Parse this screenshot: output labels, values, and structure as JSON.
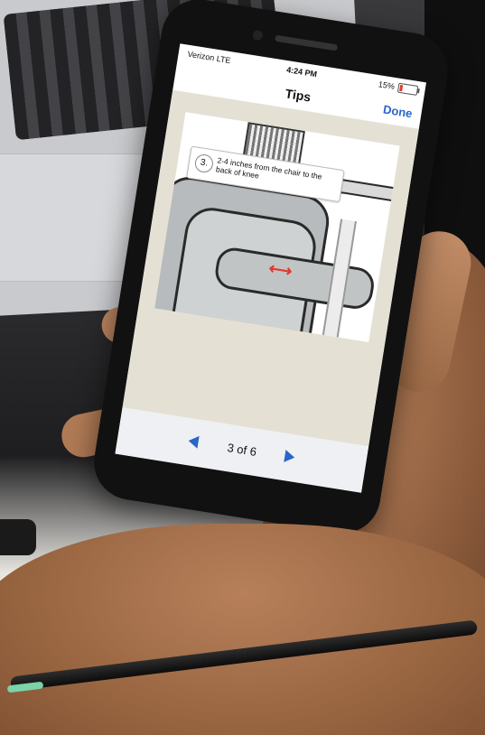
{
  "status": {
    "carrier": "Verizon  LTE",
    "time": "4:24 PM",
    "battery": "15%"
  },
  "nav": {
    "title": "Tips",
    "done_label": "Done"
  },
  "tip": {
    "step": "3.",
    "text": "2-4 inches from the chair to the back of knee"
  },
  "pager": {
    "label": "3 of 6"
  },
  "icons": {
    "prev": "triangle-left-icon",
    "next": "triangle-right-icon",
    "arrow": "double-arrow-icon",
    "battery": "battery-icon"
  },
  "colors": {
    "accent": "#2a66c8",
    "arrow": "#e03a2f",
    "content_bg": "#e4e1d4"
  }
}
